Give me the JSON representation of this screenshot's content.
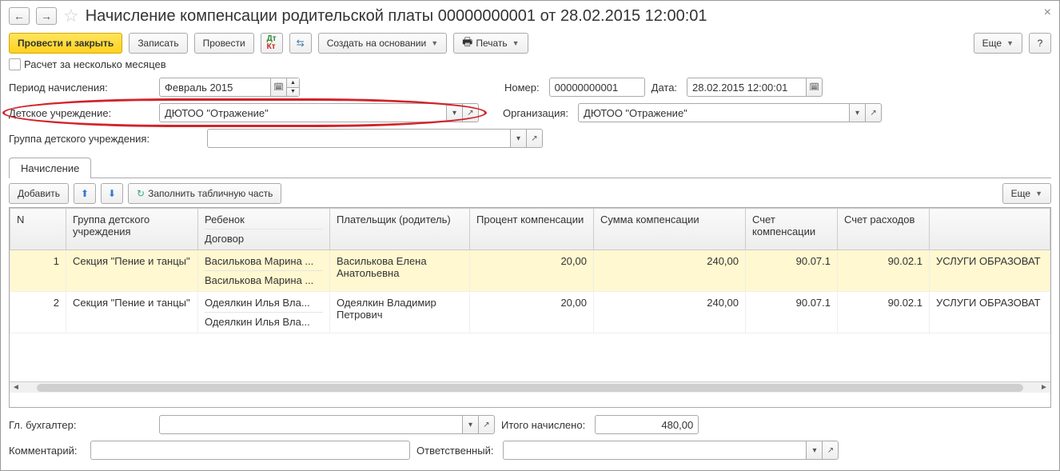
{
  "title": "Начисление компенсации родительской платы 00000000001 от 28.02.2015 12:00:01",
  "toolbar": {
    "post_close": "Провести и закрыть",
    "save": "Записать",
    "post": "Провести",
    "create_basis": "Создать на основании",
    "print": "Печать",
    "more": "Еще",
    "help": "?"
  },
  "checkbox": {
    "multi_month": "Расчет за несколько месяцев"
  },
  "fields": {
    "period_label": "Период начисления:",
    "period_value": "Февраль 2015",
    "number_label": "Номер:",
    "number_value": "00000000001",
    "date_label": "Дата:",
    "date_value": "28.02.2015 12:00:01",
    "child_org_label": "Детское учреждение:",
    "child_org_value": "ДЮТОО \"Отражение\"",
    "org_label": "Организация:",
    "org_value": "ДЮТОО \"Отражение\"",
    "group_label": "Группа детского учреждения:",
    "group_value": "",
    "accountant_label": "Гл. бухгалтер:",
    "accountant_value": "",
    "total_label": "Итого начислено:",
    "total_value": "480,00",
    "comment_label": "Комментарий:",
    "comment_value": "",
    "responsible_label": "Ответственный:",
    "responsible_value": ""
  },
  "tabs": {
    "accrual": "Начисление"
  },
  "table_toolbar": {
    "add": "Добавить",
    "fill": "Заполнить табличную часть",
    "more": "Еще"
  },
  "table": {
    "headers": {
      "n": "N",
      "group": "Группа детского учреждения",
      "child": "Ребенок",
      "contract": "Договор",
      "payer": "Плательщик (родитель)",
      "pct": "Процент компенсации",
      "sum": "Сумма компенсации",
      "acc_comp": "Счет компенсации",
      "acc_exp": "Счет расходов",
      "extra": ""
    },
    "rows": [
      {
        "n": "1",
        "group": "Секция \"Пение и танцы\"",
        "child": "Василькова Марина ...",
        "contract": "Василькова Марина ...",
        "payer": "Василькова Елена Анатольевна",
        "pct": "20,00",
        "sum": "240,00",
        "acc_comp": "90.07.1",
        "acc_exp": "90.02.1",
        "extra": "УСЛУГИ ОБРАЗОВАТ"
      },
      {
        "n": "2",
        "group": "Секция \"Пение и танцы\"",
        "child": "Одеялкин Илья Вла...",
        "contract": "Одеялкин Илья Вла...",
        "payer": "Одеялкин Владимир Петрович",
        "pct": "20,00",
        "sum": "240,00",
        "acc_comp": "90.07.1",
        "acc_exp": "90.02.1",
        "extra": "УСЛУГИ ОБРАЗОВАТ"
      }
    ]
  }
}
